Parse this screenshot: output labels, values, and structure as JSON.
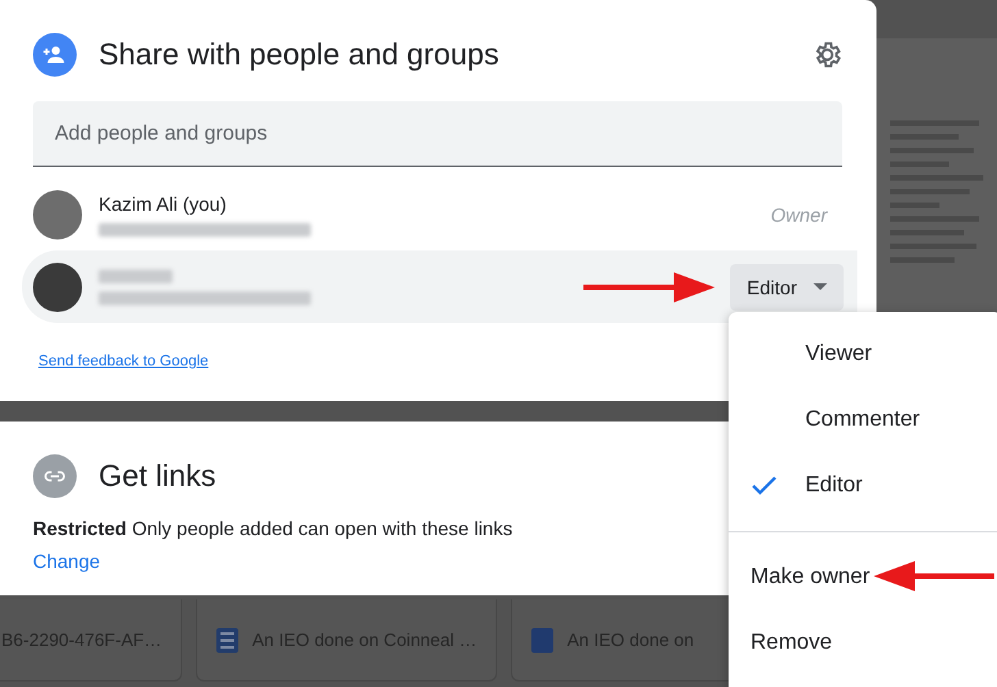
{
  "share_dialog": {
    "title": "Share with people and groups",
    "input": {
      "placeholder": "Add people and groups"
    },
    "people": [
      {
        "name": "Kazim Ali (you)",
        "kind": "owner",
        "role": "Owner",
        "selected": false
      },
      {
        "kind": "editor",
        "role": "Editor",
        "selected": true
      }
    ],
    "feedback_link": "Send feedback to Google"
  },
  "links_card": {
    "title": "Get links",
    "restriction": "**Restricted** Only people added can open with these links",
    "change_link": "Change"
  },
  "role_menu": {
    "sections": [
      [
        {
          "label": "Viewer",
          "checked": false
        },
        {
          "label": "Commenter",
          "checked": false
        },
        {
          "label": "Editor",
          "checked": true
        }
      ],
      [
        {
          "label": "Make owner",
          "checked": false
        },
        {
          "label": "Remove",
          "checked": false
        }
      ]
    ]
  },
  "files": [
    {
      "name": "B6-2290-476F-AF…",
      "kind": "plain"
    },
    {
      "name": "An IEO done on Coinneal …",
      "kind": "doc"
    },
    {
      "name": "An IEO done on",
      "kind": "word"
    }
  ]
}
